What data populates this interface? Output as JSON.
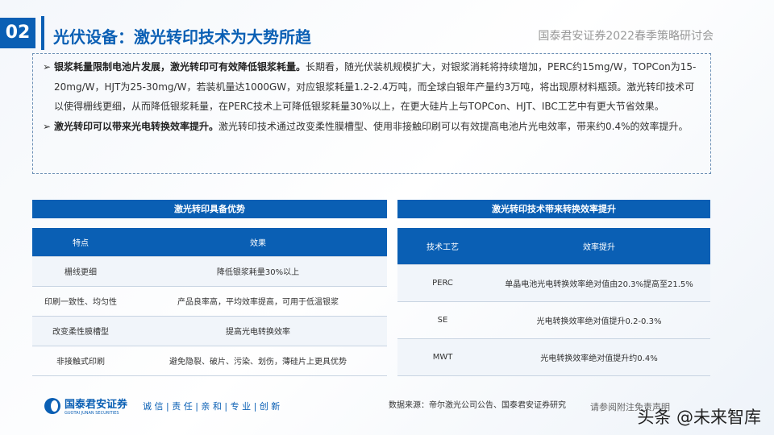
{
  "header": {
    "section_number": "02",
    "title": "光伏设备：激光转印技术为大势所趋",
    "conference": "国泰君安证券2022春季策略研讨会"
  },
  "summary": [
    {
      "bold": "银浆耗量限制电池片发展，激光转印可有效降低银浆耗量。",
      "text": "长期看，随光伏装机规模扩大，对银浆消耗将持续增加，PERC约15mg/W，TOPCon为15-20mg/W，HJT为25-30mg/W，若装机量达1000GW，对应银浆耗量1.2-2.4万吨，而全球白银年产量约3万吨，将出现原材料瓶颈。激光转印技术可以使得栅线更细，从而降低银浆耗量，在PERC技术上可降低银浆耗量30%以上，在更大硅片上与TOPCon、HJT、IBC工艺中有更大节省效果。"
    },
    {
      "bold": "激光转印可以带来光电转换效率提升。",
      "text": "激光转印技术通过改变柔性膜槽型、使用非接触印刷可以有效提高电池片光电效率，带来约0.4%的效率提升。"
    }
  ],
  "left_table": {
    "title": "激光转印具备优势",
    "headers": [
      "特点",
      "效果"
    ],
    "rows": [
      [
        "栅线更细",
        "降低银浆耗量30%以上"
      ],
      [
        "印刷一致性、均匀性",
        "产品良率高，平均效率提高，可用于低温银浆"
      ],
      [
        "改变柔性膜槽型",
        "提高光电转换效率"
      ],
      [
        "非接触式印刷",
        "避免隐裂、破片、污染、划伤，薄硅片上更具优势"
      ]
    ]
  },
  "right_table": {
    "title": "激光转印技术带来转换效率提升",
    "headers": [
      "技术工艺",
      "效率提升"
    ],
    "rows": [
      [
        "PERC",
        "单晶电池光电转换效率绝对值由20.3%提高至21.5%"
      ],
      [
        "SE",
        "光电转换效率绝对值提升0.2-0.3%"
      ],
      [
        "MWT",
        "光电转换效率绝对值提升约0.4%"
      ]
    ]
  },
  "footer": {
    "logo_cn": "国泰君安证券",
    "logo_en": "GUOTAI JUNAN SECURITIES",
    "slogan": "诚 信 | 责 任 | 亲 和 | 专 业 | 创 新",
    "source": "数据来源：帝尔激光公司公告、国泰君安证券研究",
    "disclaimer": "请参阅附注免责声明",
    "watermark": "头条 @未来智库"
  }
}
